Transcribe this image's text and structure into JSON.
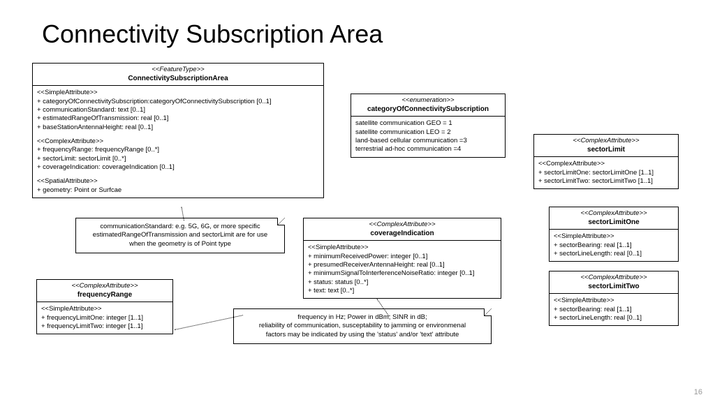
{
  "title": "Connectivity Subscription Area",
  "page_num": "16",
  "boxes": {
    "main": {
      "stereotype": "<<FeatureType>>",
      "name": "ConnectivitySubscriptionArea",
      "s1_header": "<<SimpleAttribute>>",
      "s1_a1": "+ categoryOfConnectivitySubscription:categoryOfConnectivitySubscription [0..1]",
      "s1_a2": "+ communicationStandard: text [0..1]",
      "s1_a3": "+ estimatedRangeOfTransmission: real [0..1]",
      "s1_a4": "+ baseStationAntennaHeight: real [0..1]",
      "s2_header": "<<ComplexAttribute>>",
      "s2_a1": "+ frequencyRange: frequencyRange [0..*]",
      "s2_a2": "+ sectorLimit: sectorLimit [0..*]",
      "s2_a3": "+ coverageIndication: coverageIndication [0..1]",
      "s3_header": "<<SpatialAttribute>>",
      "s3_a1": "+ geometry: Point or Surfcae"
    },
    "enum": {
      "stereotype": "<<enumeration>>",
      "name": "categoryOfConnectivitySubscription",
      "l1": "satellite communication GEO = 1",
      "l2": "satellite communication LEO = 2",
      "l3": "land-based cellular communication =3",
      "l4": "terrestrial ad-hoc communication =4"
    },
    "sectorLimit": {
      "stereotype": "<<ComplexAttribute>>",
      "name": "sectorLimit",
      "s1_header": "<<ComplexAttribute>>",
      "s1_a1": "+ sectorLimitOne: sectorLimitOne [1..1]",
      "s1_a2": "+ sectorLimitTwo: sectorLimitTwo [1..1]"
    },
    "coverage": {
      "stereotype": "<<ComplexAttribute>>",
      "name": "coverageIndication",
      "s1_header": "<<SimpleAttribute>>",
      "s1_a1": "+ minimumReceivedPower: integer [0..1]",
      "s1_a2": "+ presumedReceiverAntennaHeight: real [0..1]",
      "s1_a3": "+ minimumSignalToInterferenceNoiseRatio: integer [0..1]",
      "s1_a4": "+ status: status [0..*]",
      "s1_a5": "+ text: text [0..*]"
    },
    "sectorLimitOne": {
      "stereotype": "<<ComplexAttribute>>",
      "name": "sectorLimitOne",
      "s1_header": "<<SimpleAttribute>>",
      "s1_a1": "+ sectorBearing: real [1..1]",
      "s1_a2": "+ sectorLineLength: real [0..1]"
    },
    "sectorLimitTwo": {
      "stereotype": "<<ComplexAttribute>>",
      "name": "sectorLimitTwo",
      "s1_header": "<<SimpleAttribute>>",
      "s1_a1": "+ sectorBearing: real [1..1]",
      "s1_a2": "+ sectorLineLength: real [0..1]"
    },
    "freqRange": {
      "stereotype": "<<ComplexAttribute>>",
      "name": "frequencyRange",
      "s1_header": "<<SimpleAttribute>>",
      "s1_a1": "+ frequencyLimitOne: integer [1..1]",
      "s1_a2": "+ frequencyLimitTwo: integer [1..1]"
    }
  },
  "notes": {
    "n1_l1": "communicationStandard: e.g. 5G, 6G, or more specific",
    "n1_l2": "estimatedRangeOfTransmission and sectorLimit are for use",
    "n1_l3": "when the geometry is of Point type",
    "n2_l1": "frequency in Hz; Power in dBm; SINR in dB;",
    "n2_l2": "reliability of communication, susceptability to jamming or environmenal",
    "n2_l3": "factors may be indicated by using the 'status' and/or 'text' attribute"
  }
}
